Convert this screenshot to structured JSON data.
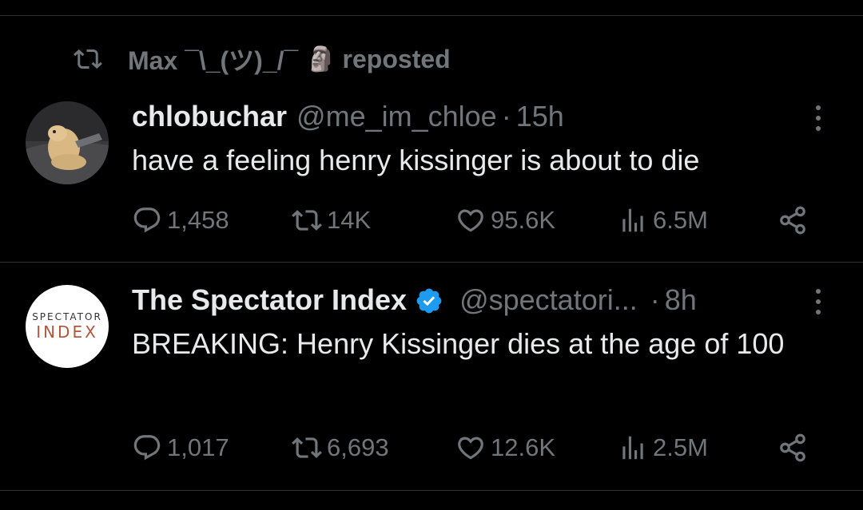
{
  "repost": {
    "user": "Max ¯\\_(ツ)_/¯",
    "emoji": "🗿",
    "label": "reposted"
  },
  "tweets": [
    {
      "name": "chlobuchar",
      "handle": "@me_im_chloe",
      "dot": "·",
      "time": "15h",
      "text": "have a feeling henry kissinger is about to die",
      "replies": "1,458",
      "reposts": "14K",
      "likes": "95.6K",
      "views": "6.5M"
    },
    {
      "name": "The Spectator Index",
      "handle": "@spectatori...",
      "dot": "·",
      "time": "8h",
      "text": "BREAKING: Henry Kissinger dies at the age of 100",
      "replies": "1,017",
      "reposts": "6,693",
      "likes": "12.6K",
      "views": "2.5M",
      "avatar_line1": "SPECTATOR",
      "avatar_line2": "INDEX"
    }
  ],
  "colors": {
    "background": "#000000",
    "text": "#e7e9ea",
    "muted": "#71767b",
    "divider": "#2f3336",
    "verified": "#1d9bf0"
  }
}
